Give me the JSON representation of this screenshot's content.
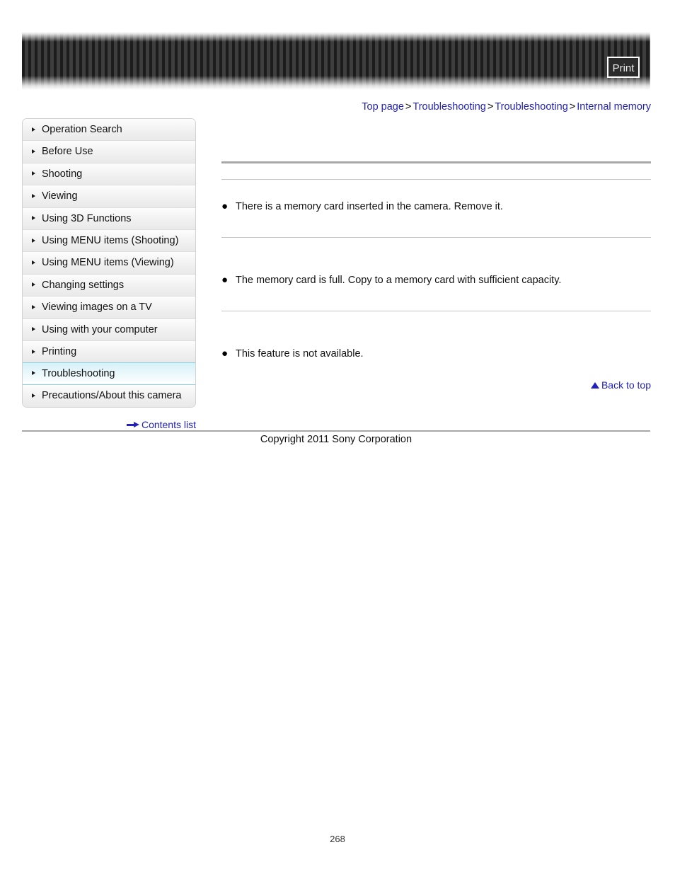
{
  "header": {
    "print_label": "Print",
    "banner_icon": "pinstripe-banner"
  },
  "breadcrumb": {
    "separator": ">",
    "items": [
      {
        "label": "Top page"
      },
      {
        "label": "Troubleshooting"
      },
      {
        "label": "Troubleshooting"
      },
      {
        "label": "Internal memory"
      }
    ]
  },
  "sidebar": {
    "items": [
      {
        "label": "Operation Search",
        "active": false
      },
      {
        "label": "Before Use",
        "active": false
      },
      {
        "label": "Shooting",
        "active": false
      },
      {
        "label": "Viewing",
        "active": false
      },
      {
        "label": "Using 3D Functions",
        "active": false
      },
      {
        "label": "Using MENU items (Shooting)",
        "active": false
      },
      {
        "label": "Using MENU items (Viewing)",
        "active": false
      },
      {
        "label": "Changing settings",
        "active": false
      },
      {
        "label": "Viewing images on a TV",
        "active": false
      },
      {
        "label": "Using with your computer",
        "active": false
      },
      {
        "label": "Printing",
        "active": false
      },
      {
        "label": "Troubleshooting",
        "active": true
      },
      {
        "label": "Precautions/About this camera",
        "active": false
      }
    ],
    "contents_list_label": "Contents list"
  },
  "main": {
    "sections": [
      {
        "heading": "",
        "bullet": "There is a memory card inserted in the camera. Remove it."
      },
      {
        "heading": "",
        "bullet": "The memory card is full. Copy to a memory card with sufficient capacity."
      },
      {
        "heading": "",
        "bullet": "This feature is not available."
      }
    ],
    "bullet_glyph": "●",
    "back_to_top_label": "Back to top"
  },
  "footer": {
    "copyright": "Copyright 2011 Sony Corporation",
    "page_number": "268"
  },
  "colors": {
    "link": "#2222bb",
    "active_nav_border": "#8fd3e6",
    "rule": "#a8a8a8"
  }
}
